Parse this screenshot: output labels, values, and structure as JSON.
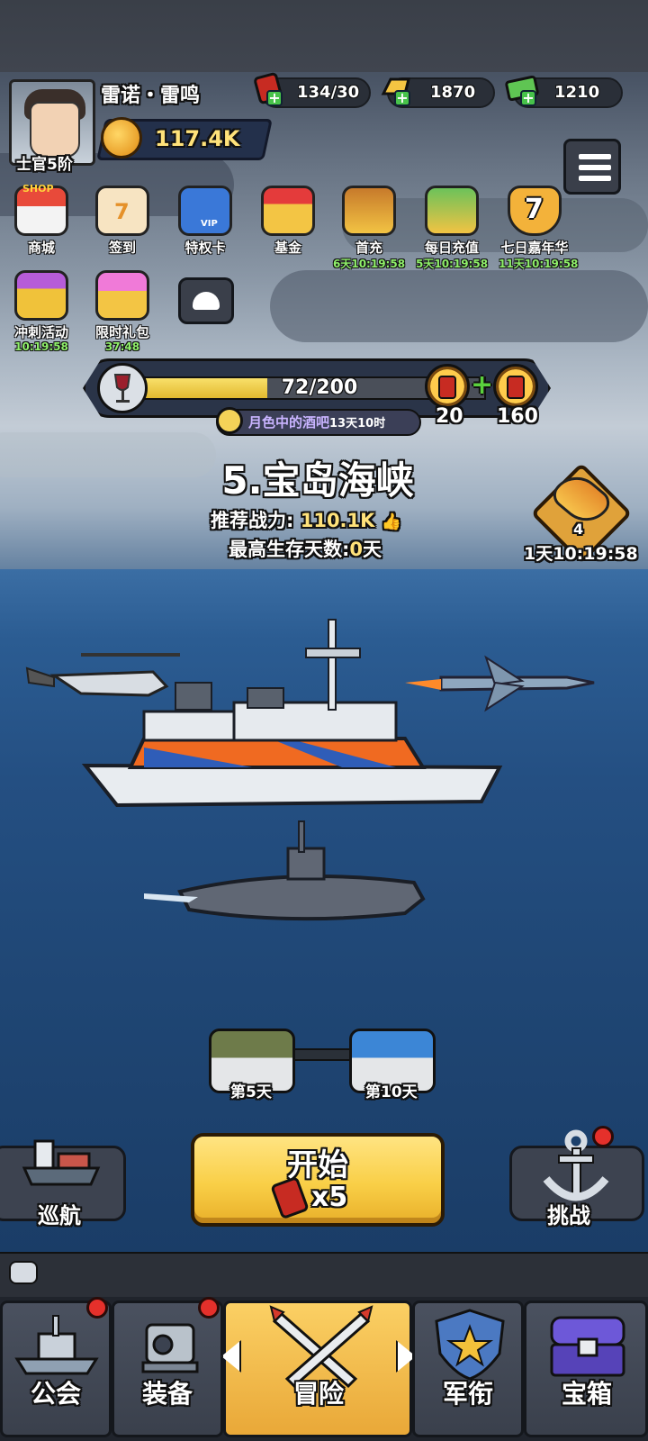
{
  "player": {
    "name": "雷诺・雷鸣",
    "rank": "士官5阶",
    "power": "117.4K"
  },
  "resources": [
    {
      "name": "fuel-barrel-icon",
      "value": "134/30"
    },
    {
      "name": "gold-bar-icon",
      "value": "1870"
    },
    {
      "name": "cash-icon",
      "value": "1210"
    }
  ],
  "features_row1": [
    {
      "label": "商城",
      "timer": ""
    },
    {
      "label": "签到",
      "timer": ""
    },
    {
      "label": "特权卡",
      "timer": ""
    },
    {
      "label": "基金",
      "timer": ""
    },
    {
      "label": "首充",
      "timer": "6天10:19:58"
    },
    {
      "label": "每日充值",
      "timer": "5天10:19:58"
    },
    {
      "label": "七日嘉年华",
      "timer": "11天10:19:58"
    }
  ],
  "features_row2": [
    {
      "label": "冲刺活动",
      "timer": "10:19:58"
    },
    {
      "label": "限时礼包",
      "timer": "37:48"
    }
  ],
  "shop_badge": "SHOP",
  "signin_day": "7",
  "vip_badge": "VIP",
  "carnival_day": "7",
  "event_progress": {
    "current_text": "72/200",
    "fraction": 0.36,
    "reward_a": "20",
    "reward_b": "160",
    "event_name": "月色中的酒吧",
    "event_time": "13天10时"
  },
  "stage": {
    "title": "5.宝岛海峡",
    "rec_power_label": "推荐战力:",
    "rec_power_value": "110.1K",
    "survive_label": "最高生存天数:",
    "survive_value": "0",
    "survive_unit": "天"
  },
  "fish_event": {
    "level": "4",
    "timer": "1天10:19:58"
  },
  "chests": [
    {
      "label": "第5天"
    },
    {
      "label": "第10天"
    }
  ],
  "buttons": {
    "cruise": "巡航",
    "start": "开始",
    "start_cost": "x5",
    "challenge": "挑战"
  },
  "nav": [
    {
      "label": "公会",
      "badge": true
    },
    {
      "label": "装备",
      "badge": true
    },
    {
      "label": "冒险",
      "badge": false
    },
    {
      "label": "军衔",
      "badge": false
    },
    {
      "label": "宝箱",
      "badge": false
    }
  ],
  "colors": {
    "accent_yellow": "#f9cf47",
    "timer_green": "#8ff06a",
    "badge_red": "#e5302b"
  }
}
